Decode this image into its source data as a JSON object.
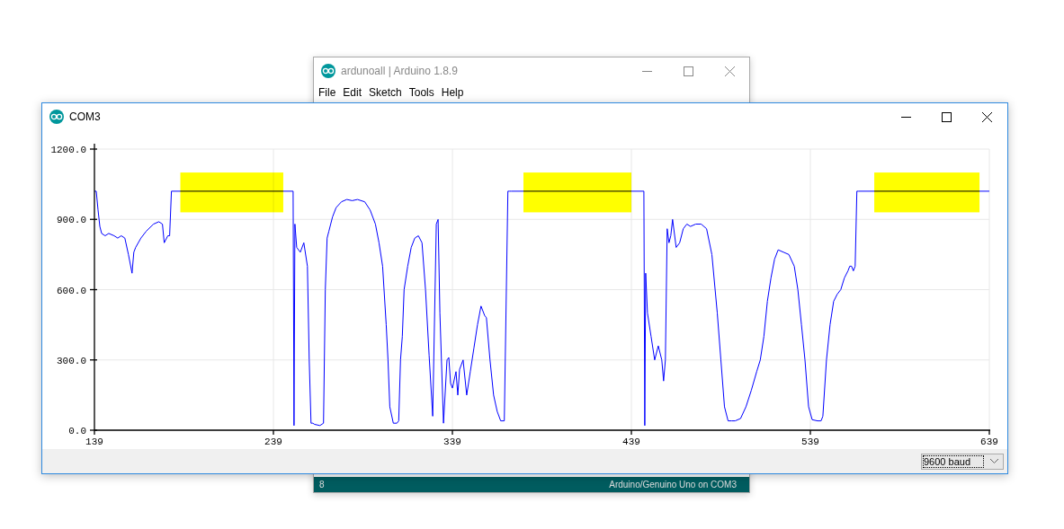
{
  "background_window": {
    "title": "ardunoall | Arduino 1.8.9",
    "menu": [
      "File",
      "Edit",
      "Sketch",
      "Tools",
      "Help"
    ],
    "status_bar": {
      "line": "8",
      "board": "Arduino/Genuino Uno on COM3"
    }
  },
  "window": {
    "title": "COM3"
  },
  "plotter": {
    "chart_data": {
      "type": "line",
      "xlim": [
        139,
        639
      ],
      "ylim": [
        0,
        1200
      ],
      "xticks": [
        139,
        239,
        339,
        439,
        539,
        639
      ],
      "yticks": [
        {
          "value": 0,
          "label": "0.0"
        },
        {
          "value": 300,
          "label": "300.0"
        },
        {
          "value": 600,
          "label": "600.0"
        },
        {
          "value": 900,
          "label": "900.0"
        },
        {
          "value": 1200,
          "label": "1200.0"
        }
      ],
      "x": [
        139,
        140,
        141,
        142,
        143,
        145,
        147,
        150,
        152,
        154,
        156,
        158,
        160,
        161,
        162,
        165,
        168,
        172,
        175,
        177,
        178,
        180,
        181,
        182,
        250,
        250.5,
        251,
        252,
        254,
        256,
        258,
        259,
        260,
        261,
        262,
        265,
        267,
        268,
        269,
        270,
        272,
        274,
        277,
        280,
        283,
        286,
        290,
        293,
        296,
        298,
        300,
        302,
        303,
        304,
        306,
        308,
        309,
        310,
        311,
        312,
        314,
        316,
        318,
        320,
        322,
        324,
        326,
        328,
        330,
        331,
        332,
        334,
        336,
        337,
        338,
        339,
        341,
        342,
        343,
        345,
        347,
        349,
        351,
        353,
        355,
        357,
        358,
        360,
        362,
        364,
        366,
        368,
        370,
        371,
        372,
        446,
        446.5,
        447,
        448,
        450,
        452,
        454,
        456,
        457,
        458,
        459,
        460,
        461,
        462,
        464,
        466,
        468,
        470,
        472,
        475,
        478,
        481,
        484,
        487,
        489,
        491,
        493,
        495,
        497,
        500,
        503,
        506,
        509,
        511,
        513,
        515,
        517,
        519,
        521,
        524,
        527,
        530,
        532,
        534,
        536,
        538,
        540,
        543,
        545,
        546,
        548,
        550,
        552,
        554,
        556,
        558,
        560,
        561,
        562,
        563,
        564,
        565,
        566,
        639
      ],
      "series": [
        {
          "color": "#0000ff",
          "values": [
            1020,
            1020,
            940,
            870,
            840,
            830,
            840,
            830,
            820,
            830,
            820,
            750,
            670,
            760,
            780,
            820,
            850,
            880,
            890,
            880,
            800,
            830,
            830,
            1020,
            1020,
            20,
            880,
            780,
            760,
            800,
            700,
            300,
            30,
            30,
            25,
            20,
            30,
            600,
            820,
            850,
            910,
            950,
            975,
            985,
            980,
            985,
            975,
            940,
            880,
            800,
            700,
            450,
            300,
            100,
            30,
            30,
            40,
            300,
            400,
            600,
            700,
            780,
            820,
            830,
            800,
            600,
            320,
            60,
            880,
            900,
            500,
            30,
            300,
            310,
            200,
            180,
            250,
            150,
            260,
            300,
            150,
            250,
            350,
            450,
            530,
            490,
            480,
            300,
            150,
            80,
            40,
            40,
            1020,
            1020,
            1020,
            1020,
            20,
            670,
            500,
            400,
            300,
            360,
            300,
            210,
            300,
            860,
            800,
            830,
            900,
            780,
            800,
            860,
            880,
            870,
            880,
            880,
            860,
            750,
            500,
            300,
            100,
            40,
            40,
            40,
            50,
            100,
            170,
            250,
            300,
            400,
            550,
            650,
            730,
            770,
            760,
            750,
            700,
            600,
            450,
            300,
            100,
            45,
            40,
            40,
            60,
            300,
            450,
            550,
            580,
            600,
            650,
            680,
            700,
            700,
            680,
            700,
            1020,
            1020,
            1020
          ]
        }
      ],
      "grid": true,
      "bands": [
        {
          "axis": "x",
          "color": "#ffff00",
          "from": 187,
          "to": 244.5
        },
        {
          "axis": "x",
          "color": "#ffff00",
          "from": 378.7,
          "to": 439
        },
        {
          "axis": "x",
          "color": "#ffff00",
          "from": 574.7,
          "to": 633.5
        }
      ]
    }
  },
  "baud_select": {
    "value": "9600 baud"
  }
}
